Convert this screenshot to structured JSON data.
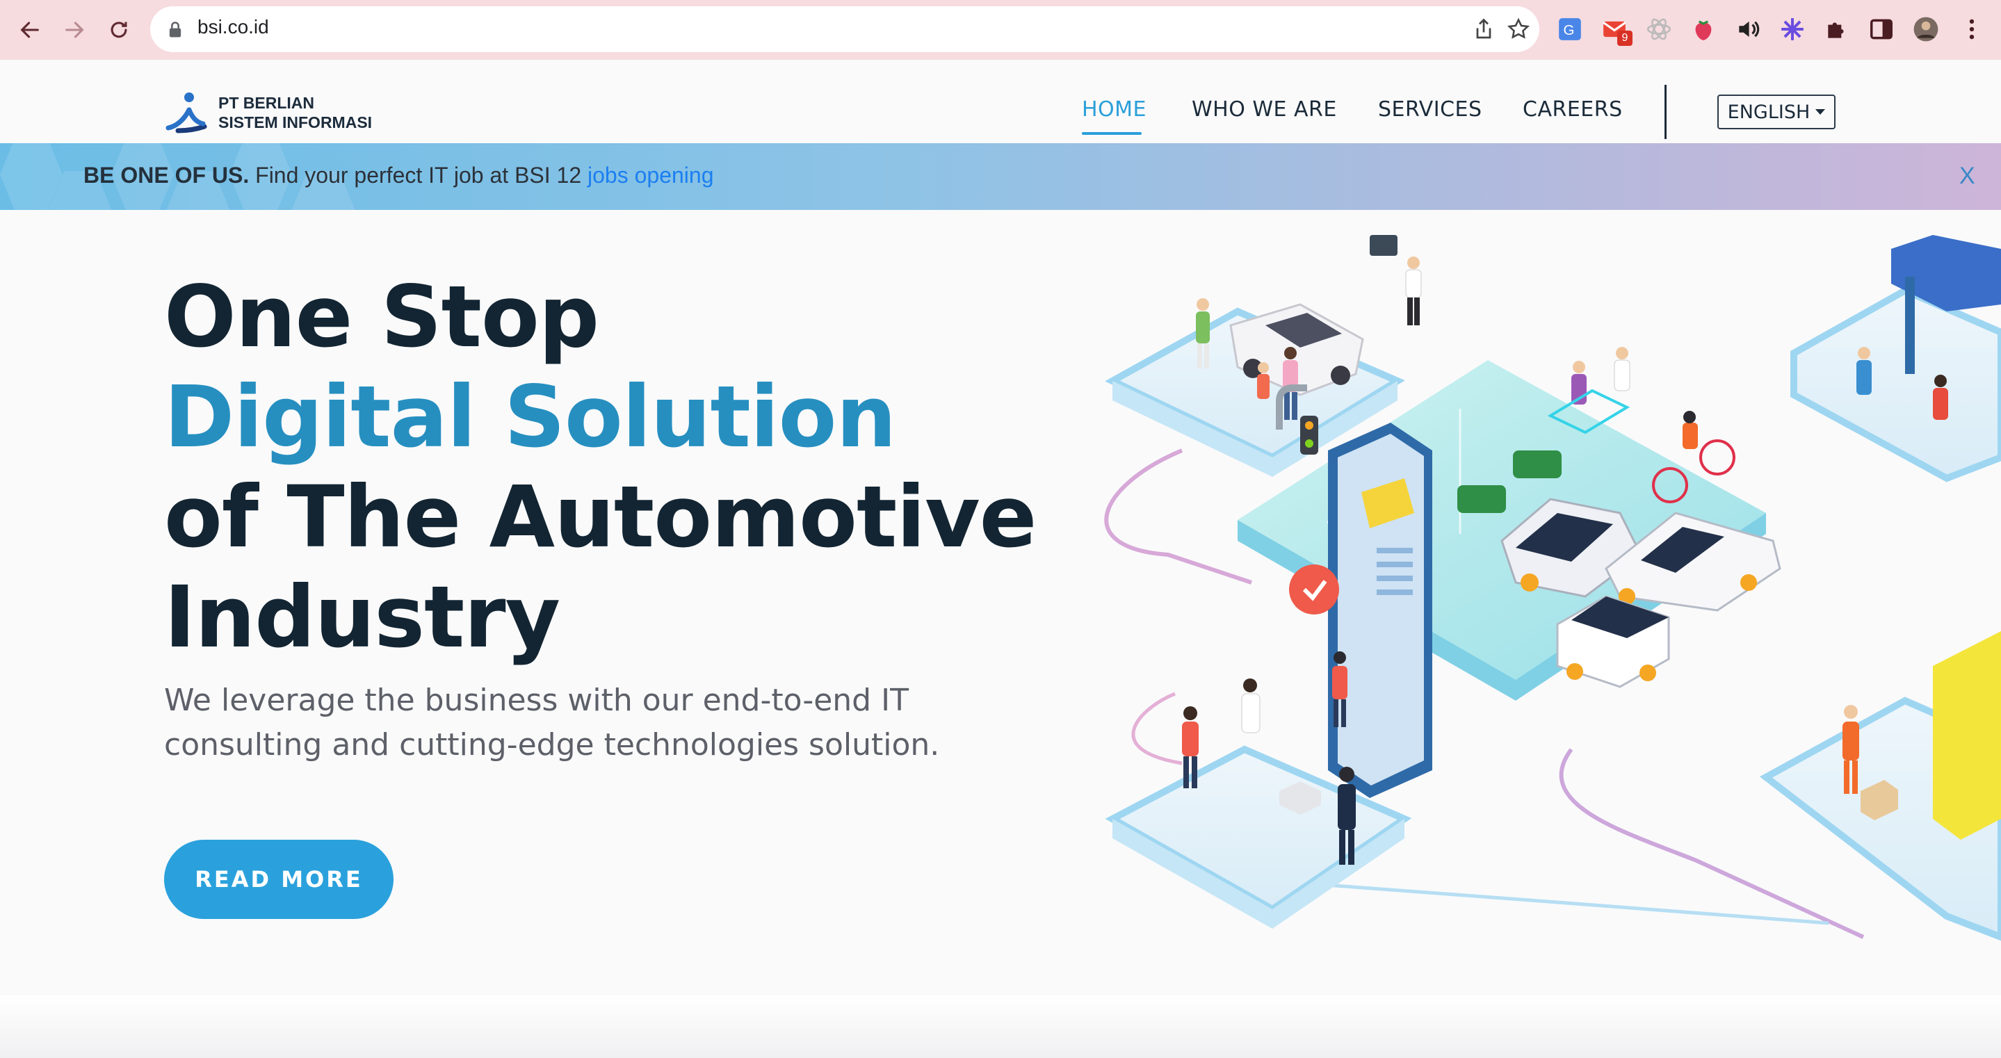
{
  "browser": {
    "url": "bsi.co.id",
    "mail_badge": "9"
  },
  "header": {
    "logo_line1": "PT BERLIAN",
    "logo_line2": "SISTEM INFORMASI",
    "menu": [
      "HOME",
      "WHO WE ARE",
      "SERVICES",
      "CAREERS"
    ],
    "active_menu": "HOME",
    "language": "ENGLISH"
  },
  "announcement": {
    "bold": "BE ONE OF US.",
    "text": " Find your perfect IT job at BSI 12 ",
    "link": "jobs opening",
    "close": "X"
  },
  "hero": {
    "title_line1": "One Stop",
    "title_line2": "Digital Solution",
    "title_line3": "of The Automotive",
    "title_line4": "Industry",
    "subtitle": "We leverage the business with our end-to-end IT consulting and cutting-edge technologies solution.",
    "button": "READ MORE"
  },
  "colors": {
    "accent": "#2aa1dc",
    "title": "#132532",
    "chrome": "#f6dbdf"
  }
}
